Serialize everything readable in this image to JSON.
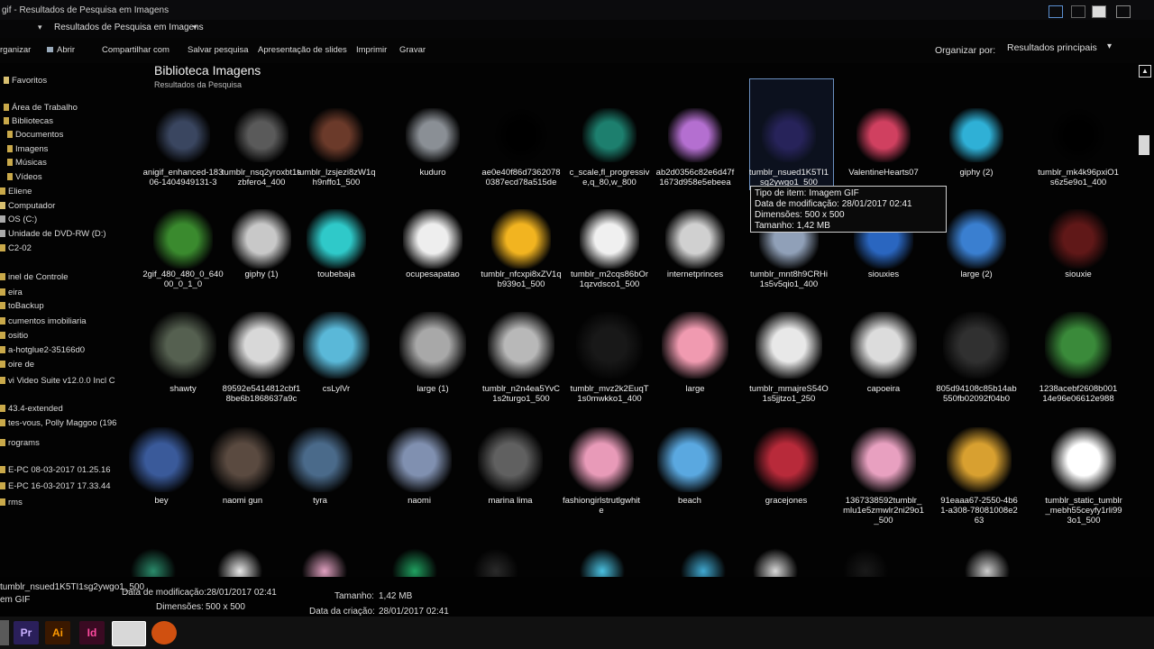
{
  "window": {
    "title": "gif - Resultados de Pesquisa em Imagens",
    "address_crumb": "Resultados de Pesquisa em Imagens"
  },
  "toolbar": {
    "organize": "rganizar",
    "open": "Abrir",
    "share": "Compartilhar com",
    "save_search": "Salvar pesquisa",
    "slideshow": "Apresentação de slides",
    "print": "Imprimir",
    "burn": "Gravar",
    "sort_label": "Organizar por:",
    "sort_value": "Resultados principais"
  },
  "sidebar": {
    "items": [
      {
        "label": "Favoritos"
      },
      {
        "label": "Área de Trabalho"
      },
      {
        "label": "Bibliotecas"
      },
      {
        "label": "Documentos"
      },
      {
        "label": "Imagens"
      },
      {
        "label": "Músicas"
      },
      {
        "label": "Vídeos"
      },
      {
        "label": "Eliene"
      },
      {
        "label": "Computador"
      },
      {
        "label": "OS (C:)"
      },
      {
        "label": "Unidade de DVD-RW (D:)"
      },
      {
        "label": "C2-02"
      },
      {
        "label": "inel de Controle"
      },
      {
        "label": "eira"
      },
      {
        "label": "toBackup"
      },
      {
        "label": "cumentos imobiliaria"
      },
      {
        "label": "ositio"
      },
      {
        "label": "a-hotglue2-35166d0"
      },
      {
        "label": "oire de"
      },
      {
        "label": "vi Video Suite v12.0.0 Incl C"
      },
      {
        "label": "43.4-extended"
      },
      {
        "label": "tes-vous, Polly Maggoo (196"
      },
      {
        "label": "rograms"
      },
      {
        "label": "E-PC 08-03-2017 01.25.16"
      },
      {
        "label": "E-PC 16-03-2017 17.33.44"
      },
      {
        "label": "rms"
      }
    ]
  },
  "library": {
    "title": "Biblioteca Imagens",
    "subtitle": "Resultados da Pesquisa"
  },
  "tiles": [
    {
      "caption": "anigif_enhanced-18306-1404949131-3",
      "color": "#3a4660"
    },
    {
      "caption": "tumblr_nsq2yroxbt1szbfero4_400",
      "color": "#5a5a5a"
    },
    {
      "caption": "tumblr_lzsjezi8zW1qh9nffo1_500",
      "color": "#6b3a2a"
    },
    {
      "caption": "kuduro",
      "color": "#8a8f95"
    },
    {
      "caption": "ae0e40f86d73620780387ecd78a515de",
      "color": "#000000"
    },
    {
      "caption": "c_scale,fl_progressive,q_80,w_800",
      "color": "#1d7f6e"
    },
    {
      "caption": "ab2d0356c82e6d47f1673d958e5ebeea",
      "color": "#b46fd0"
    },
    {
      "caption": "tumblr_nsued1K5TI1sg2ywgo1_500",
      "color": "#27235a"
    },
    {
      "caption": "ValentineHearts07",
      "color": "#d04060"
    },
    {
      "caption": "giphy (2)",
      "color": "#2fb0d6"
    },
    {
      "caption": "tumblr_mk4k96pxiO1s6z5e9o1_400",
      "color": "#000000"
    },
    {
      "caption": "2gif_480_480_0_64000_0_1_0",
      "color": "#3a8a2e"
    },
    {
      "caption": "giphy (1)",
      "color": "#c8c8c8"
    },
    {
      "caption": "toubebaja",
      "color": "#2fc9c9"
    },
    {
      "caption": "ocupesapatao",
      "color": "#eeeeee"
    },
    {
      "caption": "tumblr_nfcxpi8xZV1qb939o1_500",
      "color": "#f2b420"
    },
    {
      "caption": "tumblr_m2cqs86bOr1qzvdsco1_500",
      "color": "#f0f0f0"
    },
    {
      "caption": "internetprinces",
      "color": "#d0d0d0"
    },
    {
      "caption": "tumblr_mnt8h9CRHi1s5v5qio1_400",
      "color": "#90a0b8"
    },
    {
      "caption": "siouxies",
      "color": "#2a66c0"
    },
    {
      "caption": "large (2)",
      "color": "#3a7fd0"
    },
    {
      "caption": "siouxie",
      "color": "#601818"
    },
    {
      "caption": "shawty",
      "color": "#556050"
    },
    {
      "caption": "89592e5414812cbf18be6b1868637a9c",
      "color": "#d8d8d8"
    },
    {
      "caption": "csLylVr",
      "color": "#5ab8d8"
    },
    {
      "caption": "large (1)",
      "color": "#a8a8a8"
    },
    {
      "caption": "tumblr_n2n4ea5YvC1s2turgo1_500",
      "color": "#b8b8b8"
    },
    {
      "caption": "tumblr_mvz2k2EuqT1s0mwkko1_400",
      "color": "#181818"
    },
    {
      "caption": "large",
      "color": "#f09ab0"
    },
    {
      "caption": "tumblr_mmajreS54O1s5jjtzo1_250",
      "color": "#e8e8e8"
    },
    {
      "caption": "capoeira",
      "color": "#dcdcdc"
    },
    {
      "caption": "805d94108c85b14ab550fb02092f04b0",
      "color": "#303030"
    },
    {
      "caption": "1238acebf2608b00114e96e06612e988",
      "color": "#3a8a3a"
    },
    {
      "caption": "bey",
      "color": "#3a5a9a"
    },
    {
      "caption": "naomi gun",
      "color": "#5a4a40"
    },
    {
      "caption": "tyra",
      "color": "#4a6a8a"
    },
    {
      "caption": "naomi",
      "color": "#8090b0"
    },
    {
      "caption": "marina lima",
      "color": "#606060"
    },
    {
      "caption": "fashiongirlstrutlgwhite",
      "color": "#e89ab8"
    },
    {
      "caption": "beach",
      "color": "#5aa8e0"
    },
    {
      "caption": "gracejones",
      "color": "#b82a3a"
    },
    {
      "caption": "1367338592tumblr_mlu1e5zmwlr2ni29o1_500",
      "color": "#e8a0c0"
    },
    {
      "caption": "91eaaa67-2550-4b61-a308-78081008e263",
      "color": "#d8a030"
    },
    {
      "caption": "tumblr_static_tumblr_mebh55ceyfy1rli993o1_500",
      "color": "#ffffff"
    }
  ],
  "row5": [
    {
      "color": "#2a8a6a"
    },
    {
      "color": "#e8e8e8"
    },
    {
      "color": "#e0a0c0"
    },
    {
      "color": "#20a060"
    },
    {
      "color": "#2a2a2a"
    },
    {
      "color": "#4ac0e0"
    },
    {
      "color": "#40a8d0"
    },
    {
      "color": "#d8d8d8"
    },
    {
      "color": "#1a1a1a"
    },
    {
      "color": "#cccccc"
    }
  ],
  "tooltip": {
    "type": "Tipo de item: Imagem GIF",
    "modified": "Data de modificação: 28/01/2017 02:41",
    "dimensions": "Dimensões: 500 x 500",
    "size": "Tamanho: 1,42 MB"
  },
  "status": {
    "filename": "tumblr_nsued1K5TI1sg2ywgo1_500",
    "type": "em GIF",
    "modified_label": "Data de modificação:",
    "modified_value": "28/01/2017 02:41",
    "dimensions_label": "Dimensões:",
    "dimensions_value": "500 x 500",
    "size_label": "Tamanho:",
    "size_value": "1,42 MB",
    "created_label": "Data da criação:",
    "created_value": "28/01/2017 02:41"
  },
  "taskbar": {
    "apps": [
      {
        "name": "premiere",
        "label": "Pr",
        "color": "#2a1f5a",
        "text": "#c9b0ff"
      },
      {
        "name": "illustrator",
        "label": "Ai",
        "color": "#3a1800",
        "text": "#ff9a00"
      },
      {
        "name": "indesign",
        "label": "Id",
        "color": "#3a0a22",
        "text": "#ff4aa0"
      },
      {
        "name": "explorer",
        "label": "",
        "color": "#d8d8d8",
        "text": "#000000"
      },
      {
        "name": "firefox",
        "label": "",
        "color": "#d05010",
        "text": "#ffffff"
      }
    ]
  }
}
